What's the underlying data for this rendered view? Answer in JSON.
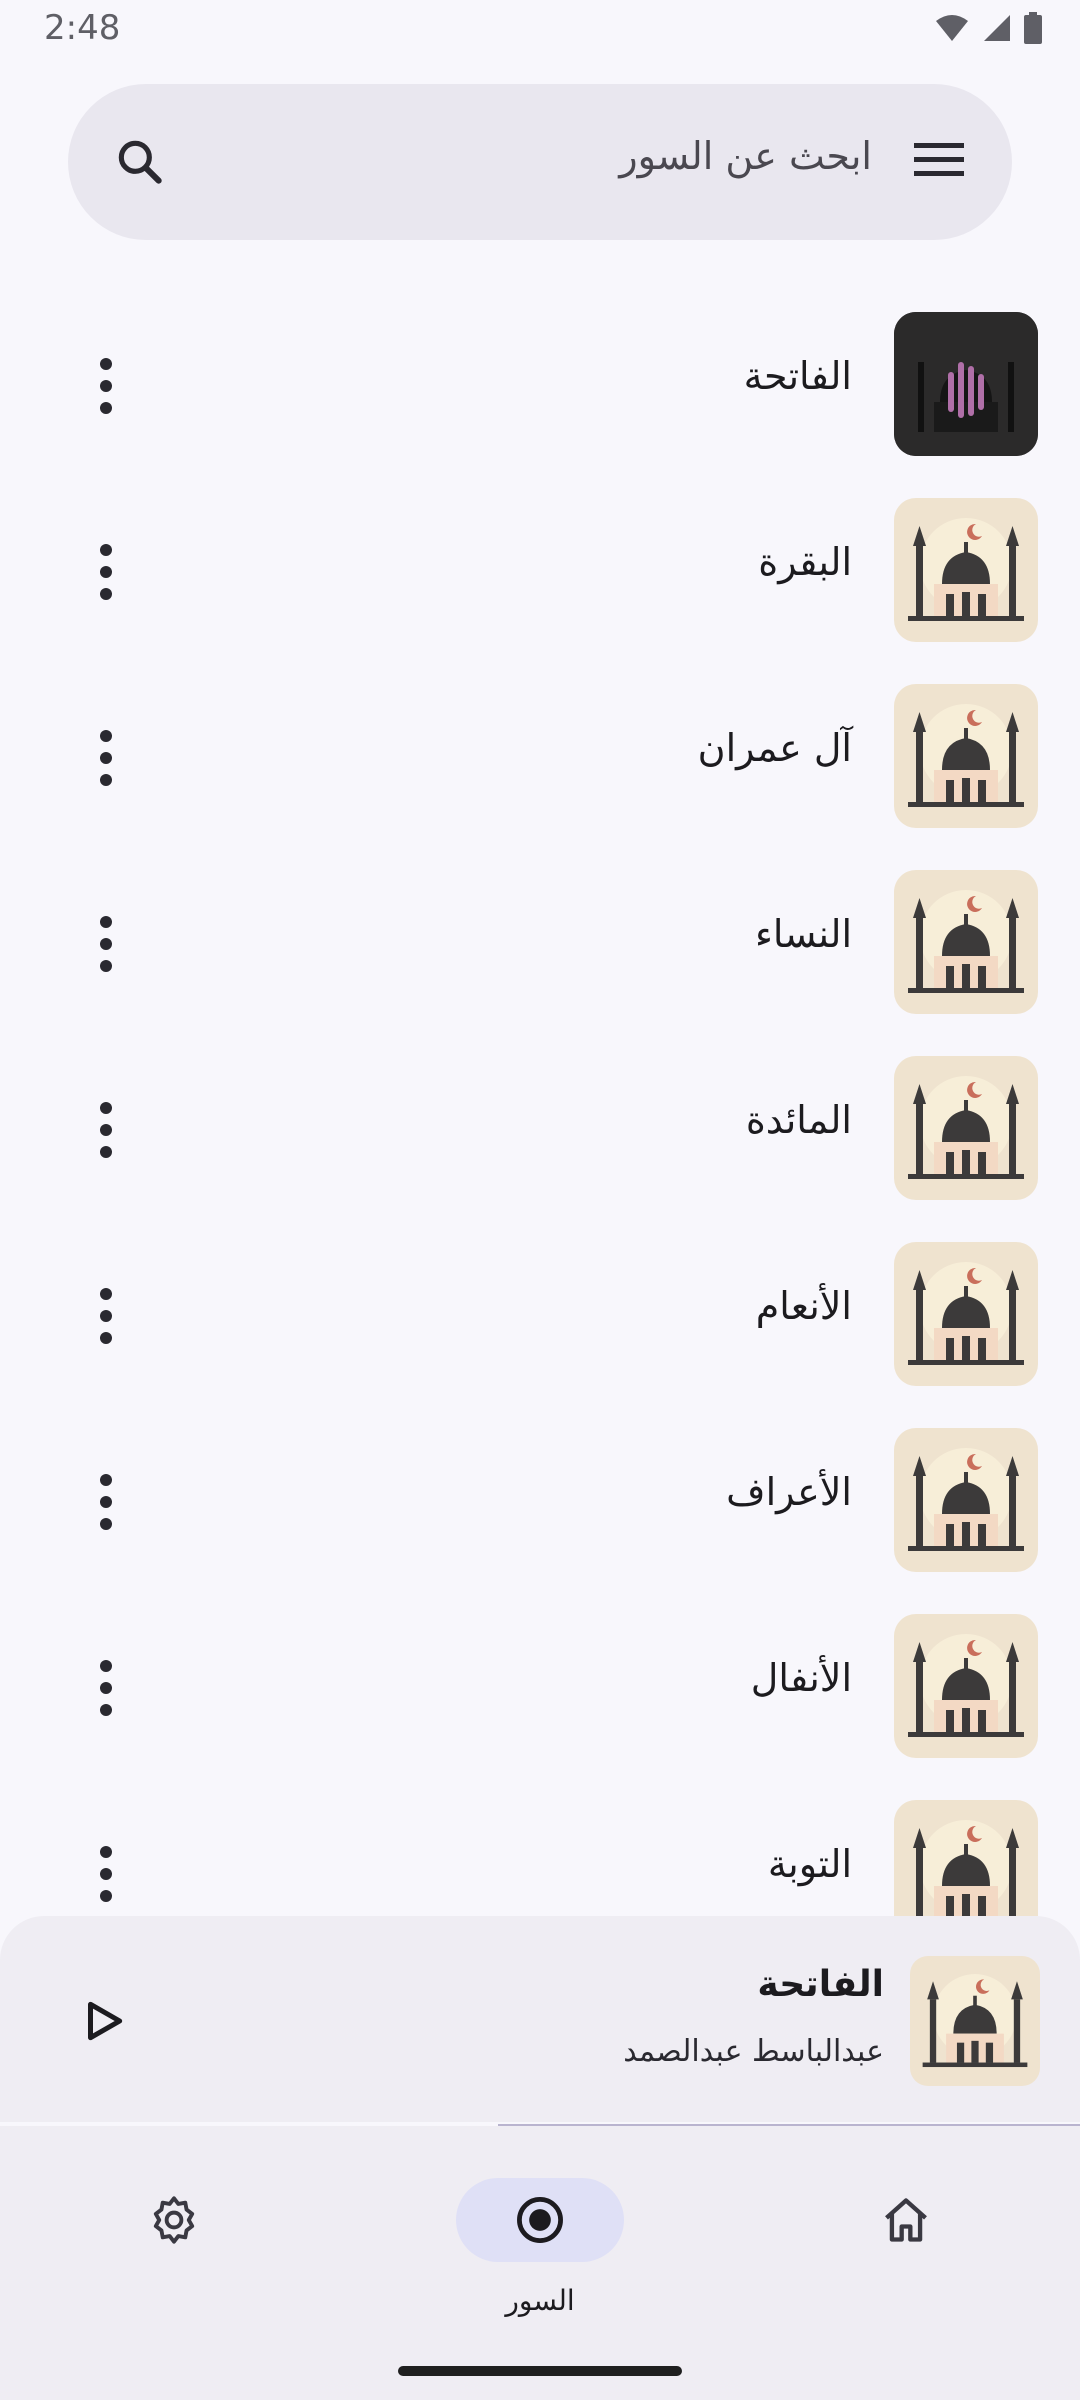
{
  "status_bar": {
    "time": "2:48",
    "icons": [
      "wifi-icon",
      "signal-icon",
      "battery-icon"
    ]
  },
  "search": {
    "placeholder": "ابحث عن السور",
    "left_icon": "search-icon",
    "right_icon": "menu-icon"
  },
  "surahs": [
    {
      "name": "الفاتحة",
      "playing": true
    },
    {
      "name": "البقرة",
      "playing": false
    },
    {
      "name": "آل عمران",
      "playing": false
    },
    {
      "name": "النساء",
      "playing": false
    },
    {
      "name": "المائدة",
      "playing": false
    },
    {
      "name": "الأنعام",
      "playing": false
    },
    {
      "name": "الأعراف",
      "playing": false
    },
    {
      "name": "الأنفال",
      "playing": false
    },
    {
      "name": "التوبة",
      "playing": false
    }
  ],
  "player": {
    "title": "الفاتحة",
    "reciter": "عبدالباسط عبدالصمد",
    "state": "paused"
  },
  "nav": {
    "settings": {
      "label": "",
      "icon": "settings-icon"
    },
    "surahs": {
      "label": "السور",
      "icon": "record-icon",
      "selected": true
    },
    "home": {
      "label": "",
      "icon": "home-icon"
    }
  },
  "colors": {
    "background": "#f8f7fc",
    "search_bg": "#e9e7ef",
    "thumb_bg": "#efe3cf",
    "nav_indicator": "#dfe0f6"
  }
}
